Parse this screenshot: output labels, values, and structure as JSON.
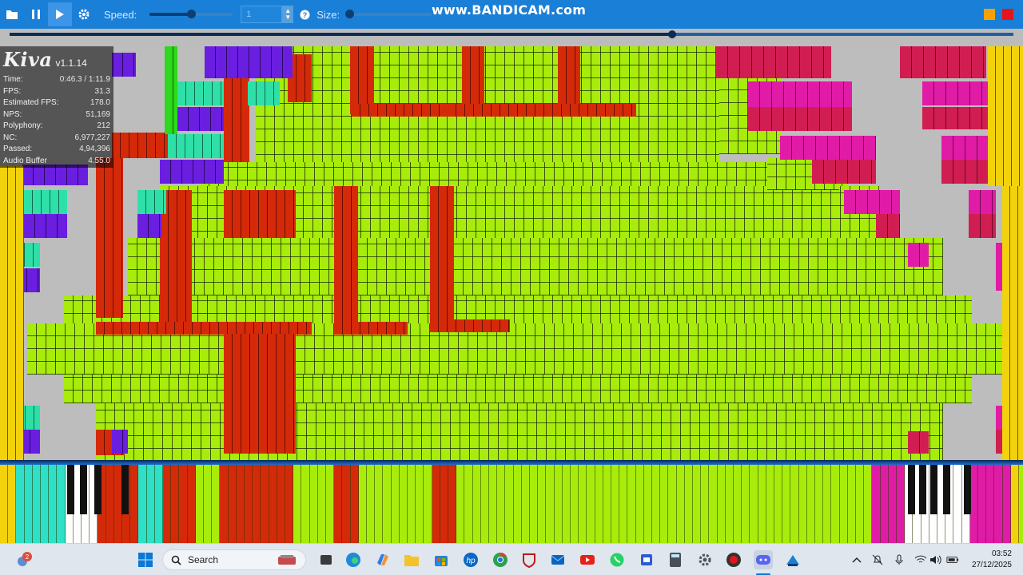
{
  "toolbar": {
    "speed_label": "Speed:",
    "speed_value": "1",
    "size_label": "Size:",
    "speed_slider_fraction": 0.5,
    "size_slider_fraction": 0.0
  },
  "watermark": "www.BANDICAM.com",
  "seek": {
    "progress_fraction": 0.66
  },
  "app": {
    "name": "Kiva",
    "version": "v1.1.14"
  },
  "stats": [
    {
      "label": "Time:",
      "value": "0:46.3 / 1:11.9"
    },
    {
      "label": "FPS:",
      "value": "31.3"
    },
    {
      "label": "Estimated FPS:",
      "value": "178.0"
    },
    {
      "label": "NPS:",
      "value": "51,169"
    },
    {
      "label": "Polyphony:",
      "value": "212"
    },
    {
      "label": "NC:",
      "value": "6,977,227"
    },
    {
      "label": "Passed:",
      "value": "4,94,396"
    },
    {
      "label": "Audio Buffer",
      "value": "4.55.0"
    }
  ],
  "taskbar": {
    "search_label": "Search",
    "notification_count": "2",
    "time": "03:52",
    "date": "27/12/2025"
  },
  "colors": {
    "toolbar": "#1a7fd6",
    "lime": "#a8ec0c",
    "red": "#d42a0a",
    "magenta": "#e01ba6",
    "purple": "#6a1ee0",
    "teal": "#2ee0a8",
    "yellow": "#f2d20c"
  },
  "icons": [
    "folder-icon",
    "pause-icon",
    "play-icon",
    "gear-icon",
    "help-icon",
    "windows-start-icon",
    "search-icon",
    "file-explorer-icon",
    "edge-icon",
    "copilot-icon",
    "store-icon",
    "hp-icon",
    "chrome-icon",
    "discord-icon",
    "whatsapp-icon",
    "calculator-icon",
    "record-icon",
    "kiva-app-icon"
  ]
}
